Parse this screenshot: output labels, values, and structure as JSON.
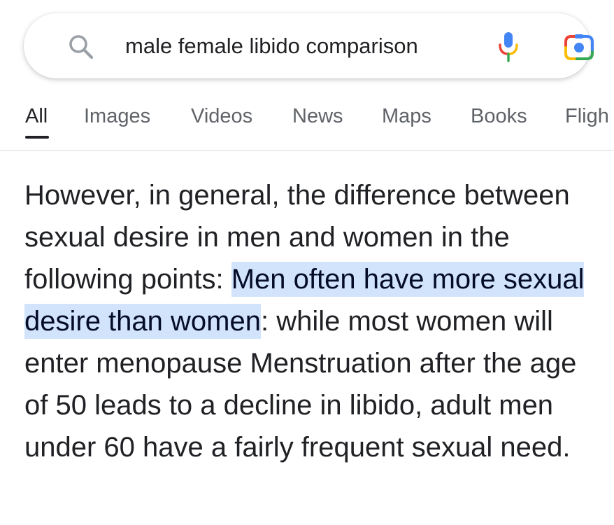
{
  "search": {
    "query": "male female libido comparison",
    "icons": {
      "left": "search-icon",
      "voice": "microphone-icon",
      "lens": "google-lens-icon"
    }
  },
  "tabs": [
    {
      "label": "All",
      "active": true
    },
    {
      "label": "Images",
      "active": false
    },
    {
      "label": "Videos",
      "active": false
    },
    {
      "label": "News",
      "active": false
    },
    {
      "label": "Maps",
      "active": false
    },
    {
      "label": "Books",
      "active": false
    },
    {
      "label": "Fligh",
      "active": false
    }
  ],
  "snippet": {
    "intro": "However, in general, the difference between sexual desire in men and women in the following points: ",
    "highlight": "Men often have more sexual desire than women",
    "rest": ": while most women will enter menopause Menstruation after the age of 50 leads to a decline in libido, adult men under 60 have a fairly frequent sexual need."
  },
  "colors": {
    "highlight_bg": "#d2e3fc",
    "text": "#202124",
    "tab_inactive": "#5f6368",
    "google_blue": "#4285f4",
    "google_red": "#ea4335",
    "google_yellow": "#fbbc04",
    "google_green": "#34a853"
  }
}
